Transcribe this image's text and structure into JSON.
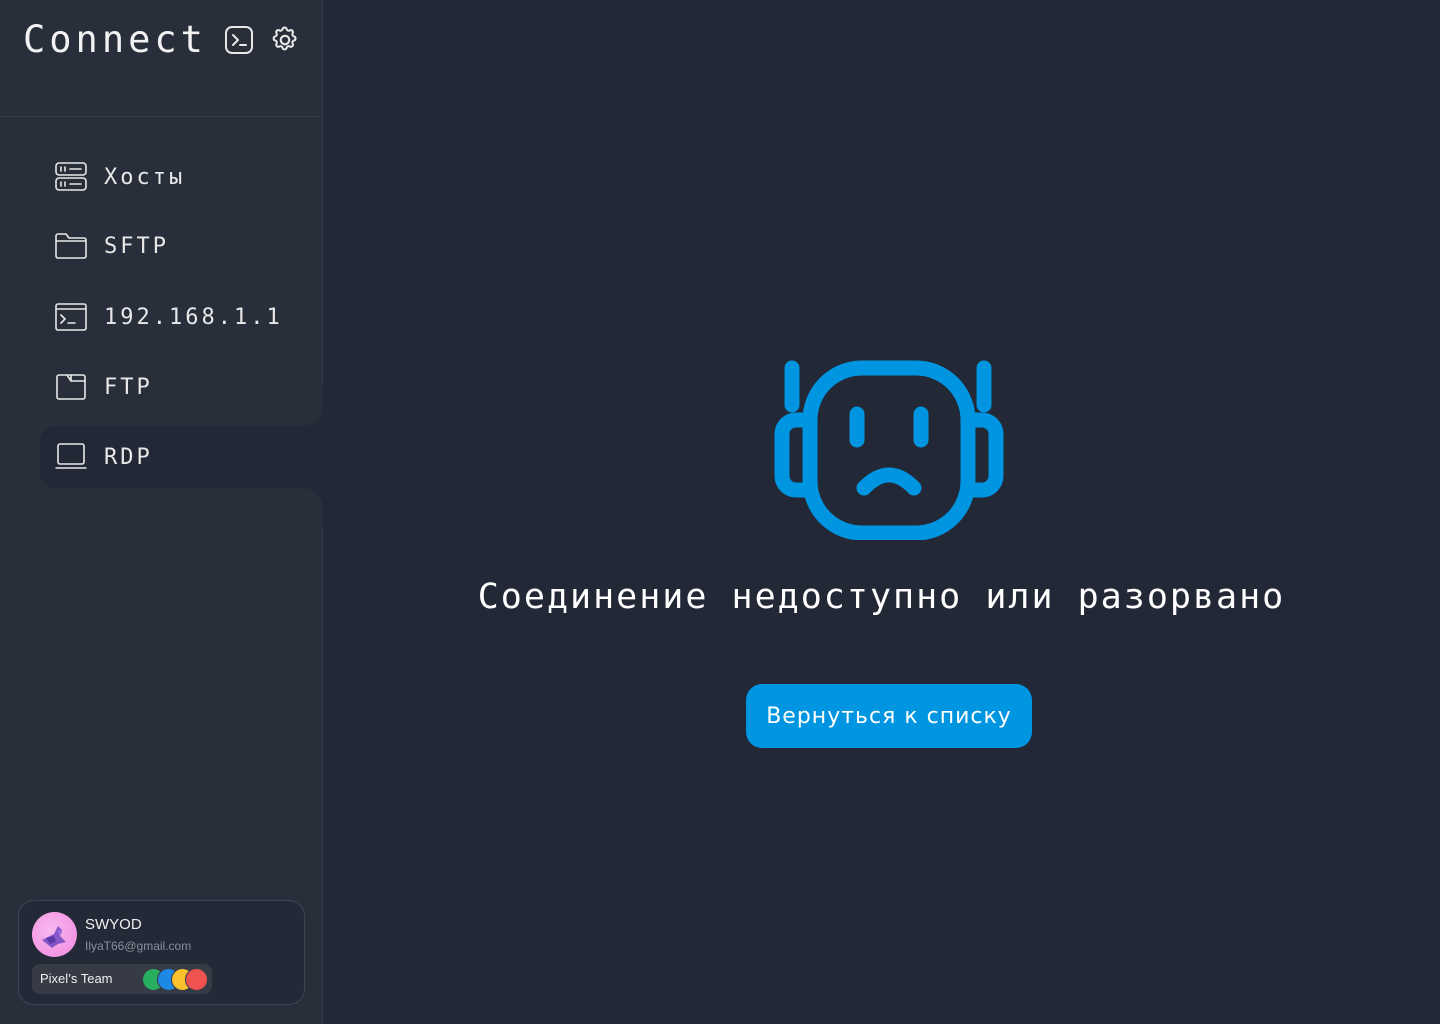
{
  "app": {
    "title": "Connect"
  },
  "toolbar": {
    "terminal_icon": "terminal-icon",
    "settings_icon": "gear-icon"
  },
  "nav": {
    "items": [
      {
        "label": "Хосты",
        "icon": "server-icon"
      },
      {
        "label": "SFTP",
        "icon": "folder-icon"
      },
      {
        "label": "192.168.1.1",
        "icon": "terminal-window-icon"
      },
      {
        "label": "FTP",
        "icon": "folder-tab-icon"
      },
      {
        "label": "RDP",
        "icon": "laptop-icon",
        "active": true
      }
    ]
  },
  "main": {
    "illustration": "sad-robot-icon",
    "message": "Соединение недоступно или разорвано",
    "back_button": "Вернуться к списку"
  },
  "profile": {
    "name": "SWYOD",
    "email": "IlyaT66@gmail.com",
    "team": "Pixel’s Team",
    "team_colors": [
      "#27ae60",
      "#1e88e5",
      "#fbc02d",
      "#ef5350"
    ]
  },
  "colors": {
    "accent": "#0095e0",
    "background": "#222835",
    "sidebar": "#282e3a"
  }
}
